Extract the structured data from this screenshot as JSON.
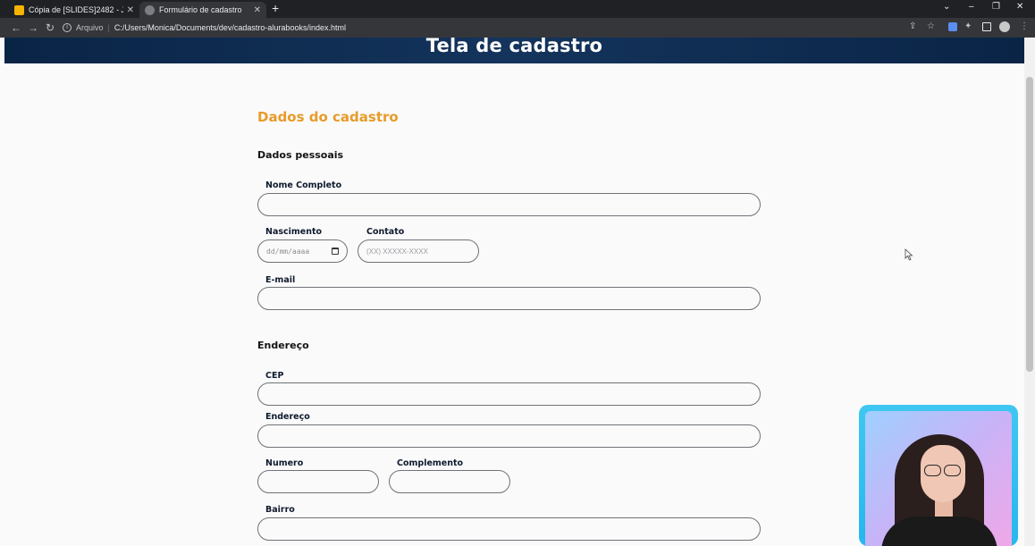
{
  "browser": {
    "tabs": [
      {
        "title": "Cópia de [SLIDES]2482 - JavaScri",
        "close": "✕",
        "favicon": "slides-icon",
        "active": false
      },
      {
        "title": "Formulário de cadastro",
        "close": "✕",
        "favicon": "globe-icon",
        "active": true
      }
    ],
    "new_tab": "+",
    "address_prefix": "Arquivo",
    "address_separator": "|",
    "url": "C:/Users/Monica/Documents/dev/cadastro-alurabooks/index.html"
  },
  "header": {
    "title": "Tela de cadastro"
  },
  "form": {
    "section_title": "Dados do cadastro",
    "personal": {
      "title": "Dados pessoais",
      "nome_label": "Nome Completo",
      "nascimento_label": "Nascimento",
      "nascimento_value": "dd/mm/aaaa",
      "contato_label": "Contato",
      "contato_placeholder": "(XX) XXXXX-XXXX",
      "email_label": "E-mail"
    },
    "address": {
      "title": "Endereço",
      "cep_label": "CEP",
      "endereco_label": "Endereço",
      "numero_label": "Numero",
      "complemento_label": "Complemento",
      "bairro_label": "Bairro"
    }
  },
  "colors": {
    "header_bg": "#0a2446",
    "section_title": "#e79b2a",
    "webcam_border": "#3fc7f1"
  }
}
